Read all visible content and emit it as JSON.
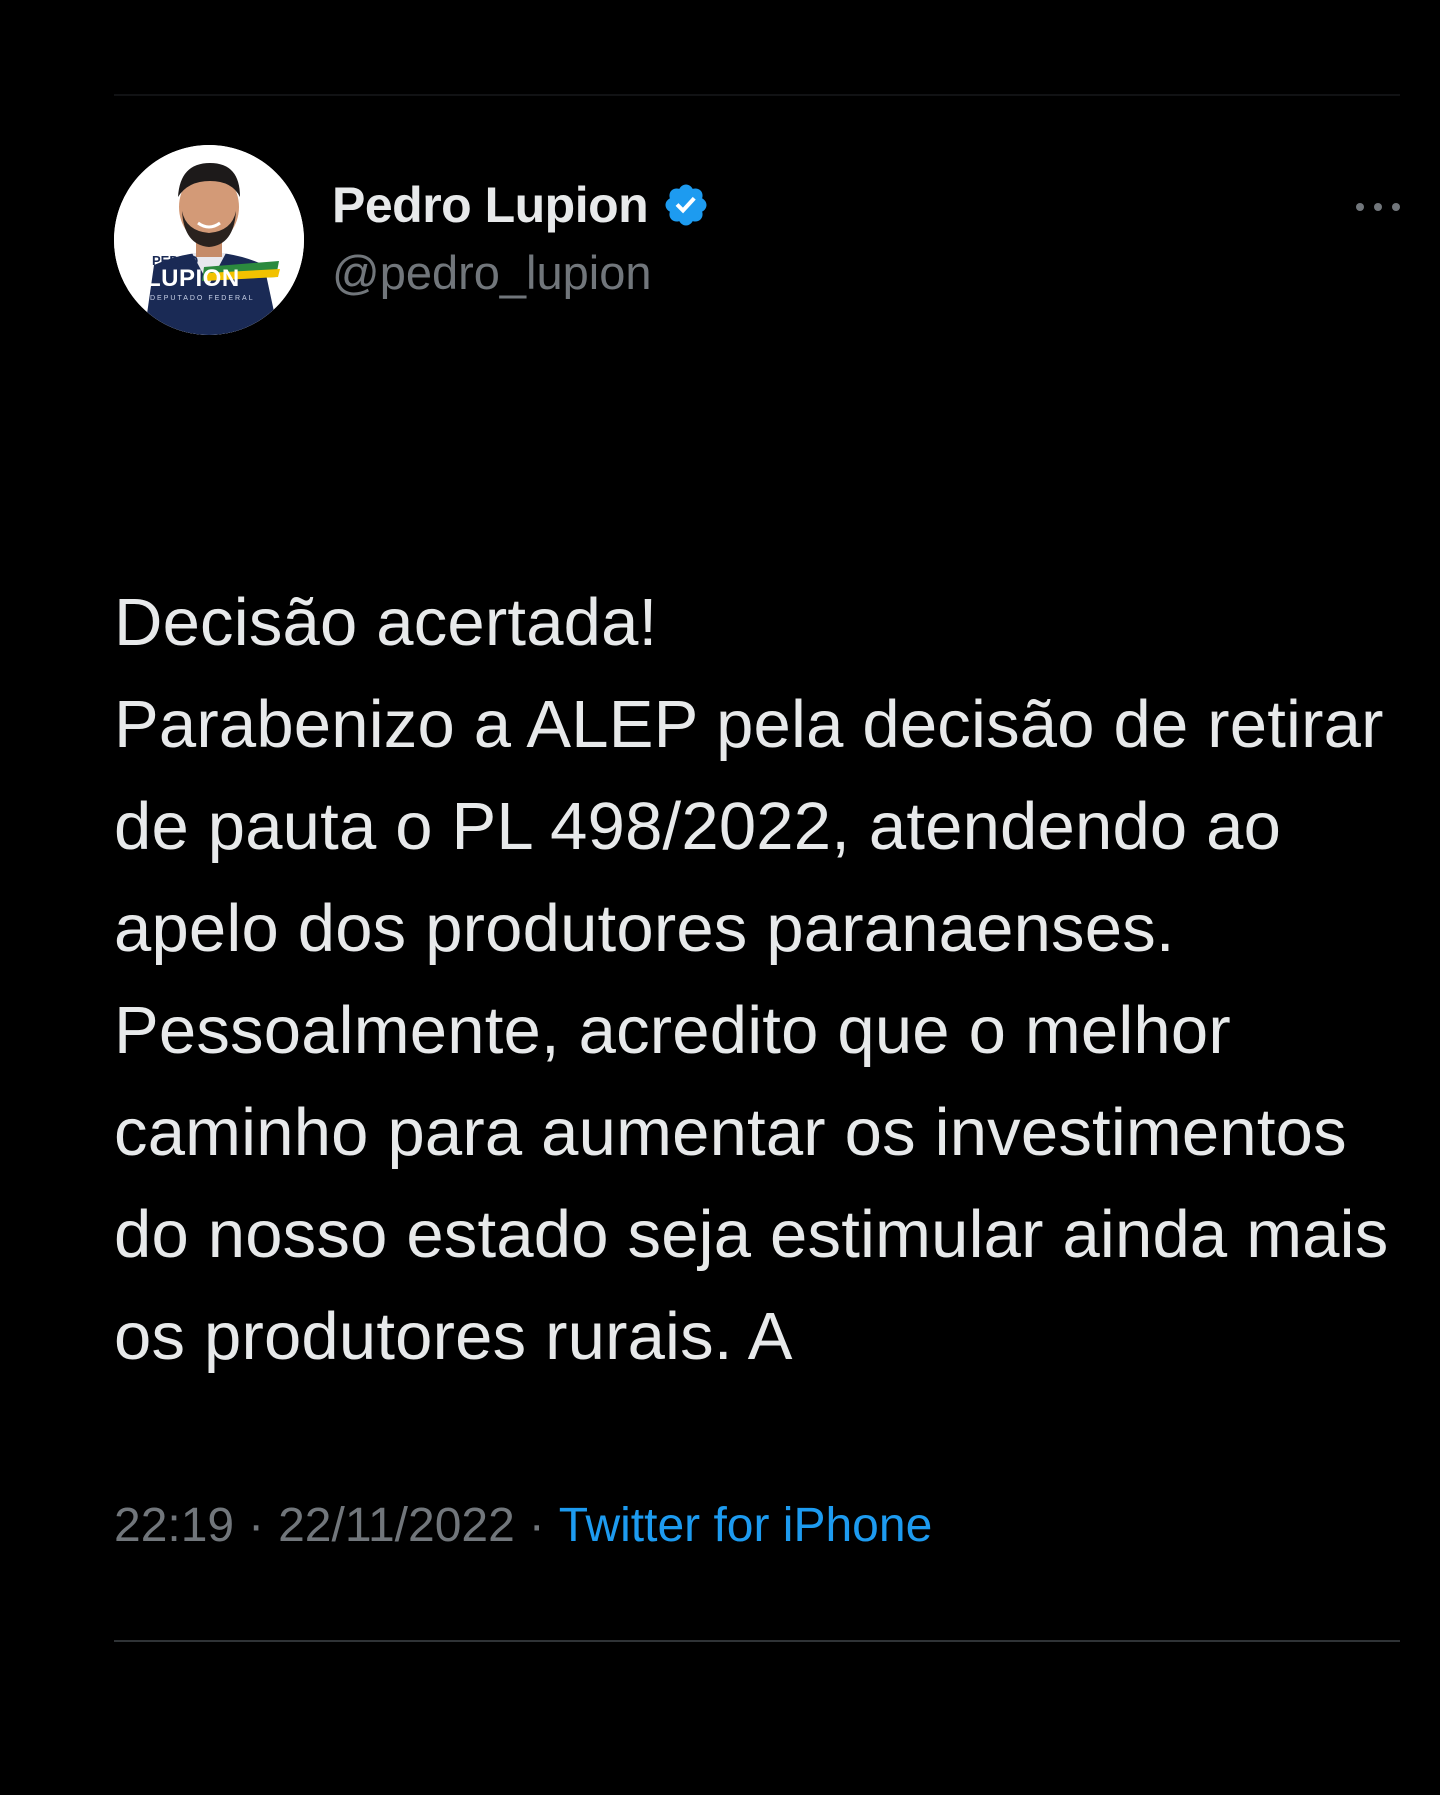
{
  "tweet": {
    "author": {
      "display_name": "Pedro Lupion",
      "handle": "@pedro_lupion",
      "verified": true,
      "avatar_text": {
        "line1": "PEDRO",
        "line2": "LUPION",
        "line3": "DEPUTADO FEDERAL"
      }
    },
    "text": "Decisão acertada!\nParabenizo a ALEP pela decisão de retirar de pauta o PL 498/2022, atendendo ao apelo dos produtores paranaenses.\nPessoalmente, acredito que o melhor caminho para aumentar os investimentos do nosso estado seja estimular ainda mais os produtores rurais. A",
    "time": "22:19",
    "date": "22/11/2022",
    "separator": "·",
    "source": "Twitter for iPhone"
  },
  "icons": {
    "verified": "verified-badge-icon",
    "more": "more-options-icon"
  },
  "colors": {
    "background": "#000000",
    "text": "#e7e9ea",
    "muted": "#71767b",
    "accent": "#1d9bf0"
  }
}
